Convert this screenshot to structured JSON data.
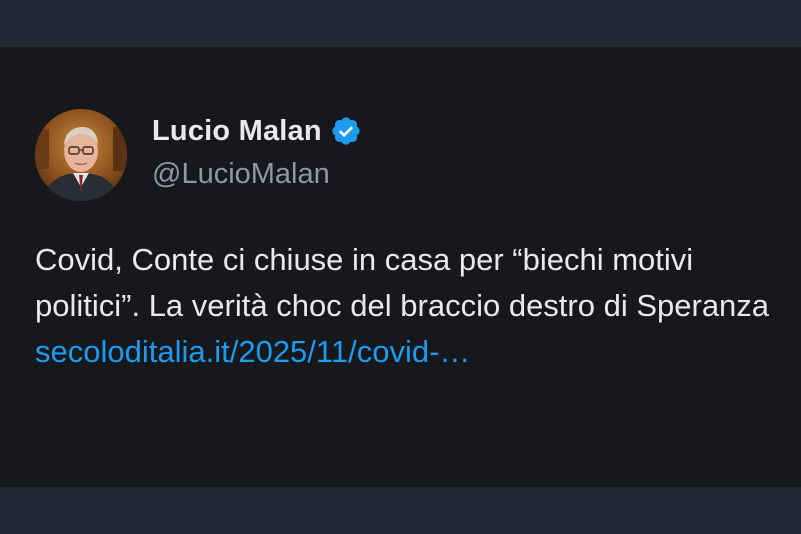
{
  "author": {
    "display_name": "Lucio Malan",
    "handle": "@LucioMalan",
    "verified": true,
    "avatar_icon": "profile-photo"
  },
  "tweet": {
    "text": "Covid, Conte ci chiuse in casa per “biechi motivi politici”. La verità choc del braccio destro di Speranza",
    "link_text": "secoloditalia.it/2025/11/covid-…"
  },
  "colors": {
    "frame_background": "#1f2833",
    "card_background": "#16181c",
    "primary_text": "#e7e9ea",
    "secondary_text": "#8b98a5",
    "link": "#1d9bf0",
    "verified_badge": "#1d9bf0"
  }
}
